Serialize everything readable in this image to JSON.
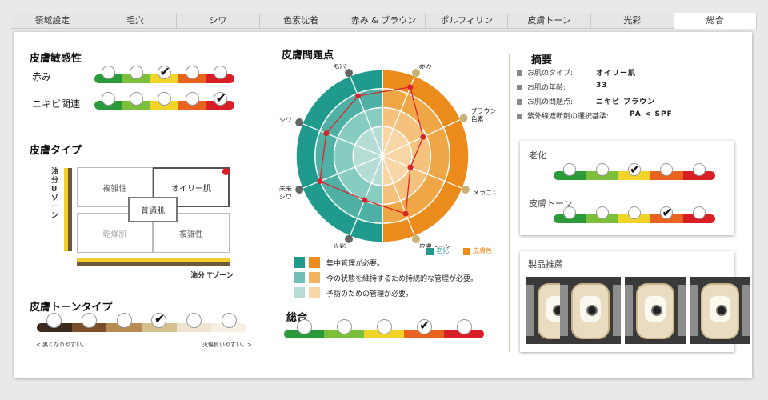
{
  "tabs": [
    "領域設定",
    "毛穴",
    "シワ",
    "色素沈着",
    "赤み & ブラウン",
    "ポルフィリン",
    "皮膚トーン",
    "光彩",
    "総合"
  ],
  "active_tab": 8,
  "sensitivity": {
    "title": "皮膚敏感性",
    "rows": [
      {
        "label": "赤み",
        "selected": 2
      },
      {
        "label": "ニキビ関連",
        "selected": 4
      }
    ]
  },
  "skin_type": {
    "title": "皮膚タイプ",
    "y_axis": "油分 Uゾーン",
    "x_axis": "油分 Tゾーン",
    "cells": {
      "top_left": "複雑性",
      "top_right": "オイリー肌",
      "center": "普通肌",
      "bottom_left": "乾燥肌",
      "bottom_right": "複雑性"
    },
    "selected": "オイリー肌"
  },
  "tone_type": {
    "title": "皮膚トーンタイプ",
    "selected": 3,
    "left_note": "< 黒くなりやすい。",
    "right_note": "火傷負いやすい。>",
    "colors": [
      "#3b2a1e",
      "#7a4f2a",
      "#b88b52",
      "#d8c08e",
      "#eee4cf",
      "#f6f0e4"
    ]
  },
  "problems": {
    "title": "皮膚問題点",
    "labels": [
      "毛穴",
      "赤み",
      "ブラウン\n色素",
      "メラニン",
      "皮膚トーン",
      "光彩",
      "未来\nシワ",
      "シワ"
    ],
    "legend": [
      {
        "label": "老化",
        "color": "#1f9a8c"
      },
      {
        "label": "皮膚色",
        "color": "#ea8b1c"
      }
    ],
    "levels": [
      {
        "label": "集中管理が必要。",
        "c1": "#1f9a8c",
        "c2": "#ea8b1c"
      },
      {
        "label": "今の状態を維持するため持続的な管理が必要。",
        "c1": "#6fc1b5",
        "c2": "#f2b35f"
      },
      {
        "label": "予防のための管理が必要。",
        "c1": "#b5ddd6",
        "c2": "#f8d6a6"
      }
    ],
    "radar_values": [
      0.75,
      0.86,
      0.52,
      0.35,
      0.72,
      0.55,
      0.78,
      0.7
    ]
  },
  "overall": {
    "title": "総合",
    "selected": 3
  },
  "summary": {
    "title": "摘要",
    "rows": [
      {
        "k": "お肌のタイプ:",
        "v": "オイリー肌"
      },
      {
        "k": "お肌の年齢:",
        "v": "33"
      },
      {
        "k": "お肌の問題点:",
        "v": "ニキビ ブラウン"
      },
      {
        "k": "紫外線遮断剤の選択基準:",
        "v": "PA < SPF"
      }
    ]
  },
  "aging": {
    "title": "老化",
    "selected": 2
  },
  "skin_tone": {
    "title": "皮膚トーン",
    "selected": 3
  },
  "products": {
    "title": "製品推薦"
  },
  "scale_colors": [
    "#2b9a3a",
    "#7cbf3a",
    "#f2d428",
    "#e8631f",
    "#d81f26"
  ]
}
